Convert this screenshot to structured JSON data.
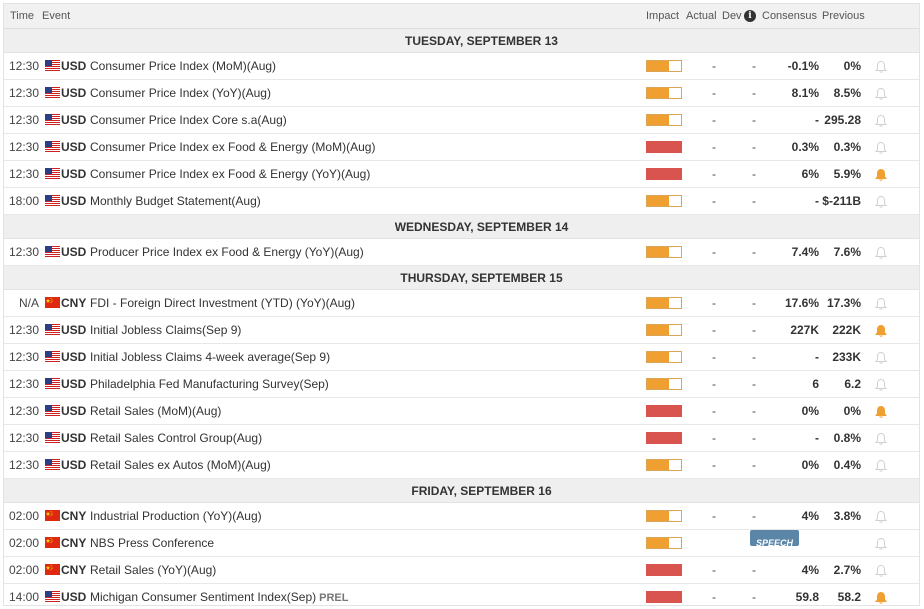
{
  "columns": {
    "time": "Time",
    "event": "Event",
    "impact": "Impact",
    "actual": "Actual",
    "dev": "Dev",
    "consensus": "Consensus",
    "previous": "Previous"
  },
  "colors": {
    "impact_medium": "#f0a030",
    "impact_high": "#d9534f",
    "bell_active": "#f0a030",
    "bell_inactive": "#d8d8d8",
    "header_bg": "#f1f1f1"
  },
  "days": [
    {
      "label": "TUESDAY, SEPTEMBER 13",
      "rows": [
        {
          "time": "12:30",
          "flag": "us-flag-icon",
          "currency": "USD",
          "event": "Consumer Price Index (MoM)(Aug)",
          "impact": "medium",
          "actual": "-",
          "dev": "-",
          "consensus": "-0.1%",
          "previous": "0%",
          "alert": false
        },
        {
          "time": "12:30",
          "flag": "us-flag-icon",
          "currency": "USD",
          "event": "Consumer Price Index (YoY)(Aug)",
          "impact": "medium",
          "actual": "-",
          "dev": "-",
          "consensus": "8.1%",
          "previous": "8.5%",
          "alert": false
        },
        {
          "time": "12:30",
          "flag": "us-flag-icon",
          "currency": "USD",
          "event": "Consumer Price Index Core s.a(Aug)",
          "impact": "medium",
          "actual": "-",
          "dev": "-",
          "consensus": "-",
          "previous": "295.28",
          "alert": false
        },
        {
          "time": "12:30",
          "flag": "us-flag-icon",
          "currency": "USD",
          "event": "Consumer Price Index ex Food & Energy (MoM)(Aug)",
          "impact": "high",
          "actual": "-",
          "dev": "-",
          "consensus": "0.3%",
          "previous": "0.3%",
          "alert": false
        },
        {
          "time": "12:30",
          "flag": "us-flag-icon",
          "currency": "USD",
          "event": "Consumer Price Index ex Food & Energy (YoY)(Aug)",
          "impact": "high",
          "actual": "-",
          "dev": "-",
          "consensus": "6%",
          "previous": "5.9%",
          "alert": true
        },
        {
          "time": "18:00",
          "flag": "us-flag-icon",
          "currency": "USD",
          "event": "Monthly Budget Statement(Aug)",
          "impact": "medium",
          "actual": "-",
          "dev": "-",
          "consensus": "-",
          "previous": "$-211B",
          "alert": false
        }
      ]
    },
    {
      "label": "WEDNESDAY, SEPTEMBER 14",
      "rows": [
        {
          "time": "12:30",
          "flag": "us-flag-icon",
          "currency": "USD",
          "event": "Producer Price Index ex Food & Energy (YoY)(Aug)",
          "impact": "medium",
          "actual": "-",
          "dev": "-",
          "consensus": "7.4%",
          "previous": "7.6%",
          "alert": false
        }
      ]
    },
    {
      "label": "THURSDAY, SEPTEMBER 15",
      "rows": [
        {
          "time": "N/A",
          "flag": "cn-flag-icon",
          "currency": "CNY",
          "event": "FDI - Foreign Direct Investment (YTD) (YoY)(Aug)",
          "impact": "medium",
          "actual": "-",
          "dev": "-",
          "consensus": "17.6%",
          "previous": "17.3%",
          "alert": false
        },
        {
          "time": "12:30",
          "flag": "us-flag-icon",
          "currency": "USD",
          "event": "Initial Jobless Claims(Sep 9)",
          "impact": "medium",
          "actual": "-",
          "dev": "-",
          "consensus": "227K",
          "previous": "222K",
          "alert": true
        },
        {
          "time": "12:30",
          "flag": "us-flag-icon",
          "currency": "USD",
          "event": "Initial Jobless Claims 4-week average(Sep 9)",
          "impact": "medium",
          "actual": "-",
          "dev": "-",
          "consensus": "-",
          "previous": "233K",
          "alert": false
        },
        {
          "time": "12:30",
          "flag": "us-flag-icon",
          "currency": "USD",
          "event": "Philadelphia Fed Manufacturing Survey(Sep)",
          "impact": "medium",
          "actual": "-",
          "dev": "-",
          "consensus": "6",
          "previous": "6.2",
          "alert": false
        },
        {
          "time": "12:30",
          "flag": "us-flag-icon",
          "currency": "USD",
          "event": "Retail Sales (MoM)(Aug)",
          "impact": "high",
          "actual": "-",
          "dev": "-",
          "consensus": "0%",
          "previous": "0%",
          "alert": true
        },
        {
          "time": "12:30",
          "flag": "us-flag-icon",
          "currency": "USD",
          "event": "Retail Sales Control Group(Aug)",
          "impact": "high",
          "actual": "-",
          "dev": "-",
          "consensus": "-",
          "previous": "0.8%",
          "alert": false
        },
        {
          "time": "12:30",
          "flag": "us-flag-icon",
          "currency": "USD",
          "event": "Retail Sales ex Autos (MoM)(Aug)",
          "impact": "medium",
          "actual": "-",
          "dev": "-",
          "consensus": "0%",
          "previous": "0.4%",
          "alert": false
        }
      ]
    },
    {
      "label": "FRIDAY, SEPTEMBER 16",
      "rows": [
        {
          "time": "02:00",
          "flag": "cn-flag-icon",
          "currency": "CNY",
          "event": "Industrial Production (YoY)(Aug)",
          "impact": "medium",
          "actual": "-",
          "dev": "-",
          "consensus": "4%",
          "previous": "3.8%",
          "alert": false
        },
        {
          "time": "02:00",
          "flag": "cn-flag-icon",
          "currency": "CNY",
          "event": "NBS Press Conference",
          "impact": "medium",
          "speech": "SPEECH",
          "alert": false
        },
        {
          "time": "02:00",
          "flag": "cn-flag-icon",
          "currency": "CNY",
          "event": "Retail Sales (YoY)(Aug)",
          "impact": "high",
          "actual": "-",
          "dev": "-",
          "consensus": "4%",
          "previous": "2.7%",
          "alert": false
        },
        {
          "time": "14:00",
          "flag": "us-flag-icon",
          "currency": "USD",
          "event": "Michigan Consumer Sentiment Index(Sep)",
          "tag": "PREL",
          "impact": "high",
          "actual": "-",
          "dev": "-",
          "consensus": "59.8",
          "previous": "58.2",
          "alert": true
        }
      ]
    }
  ]
}
